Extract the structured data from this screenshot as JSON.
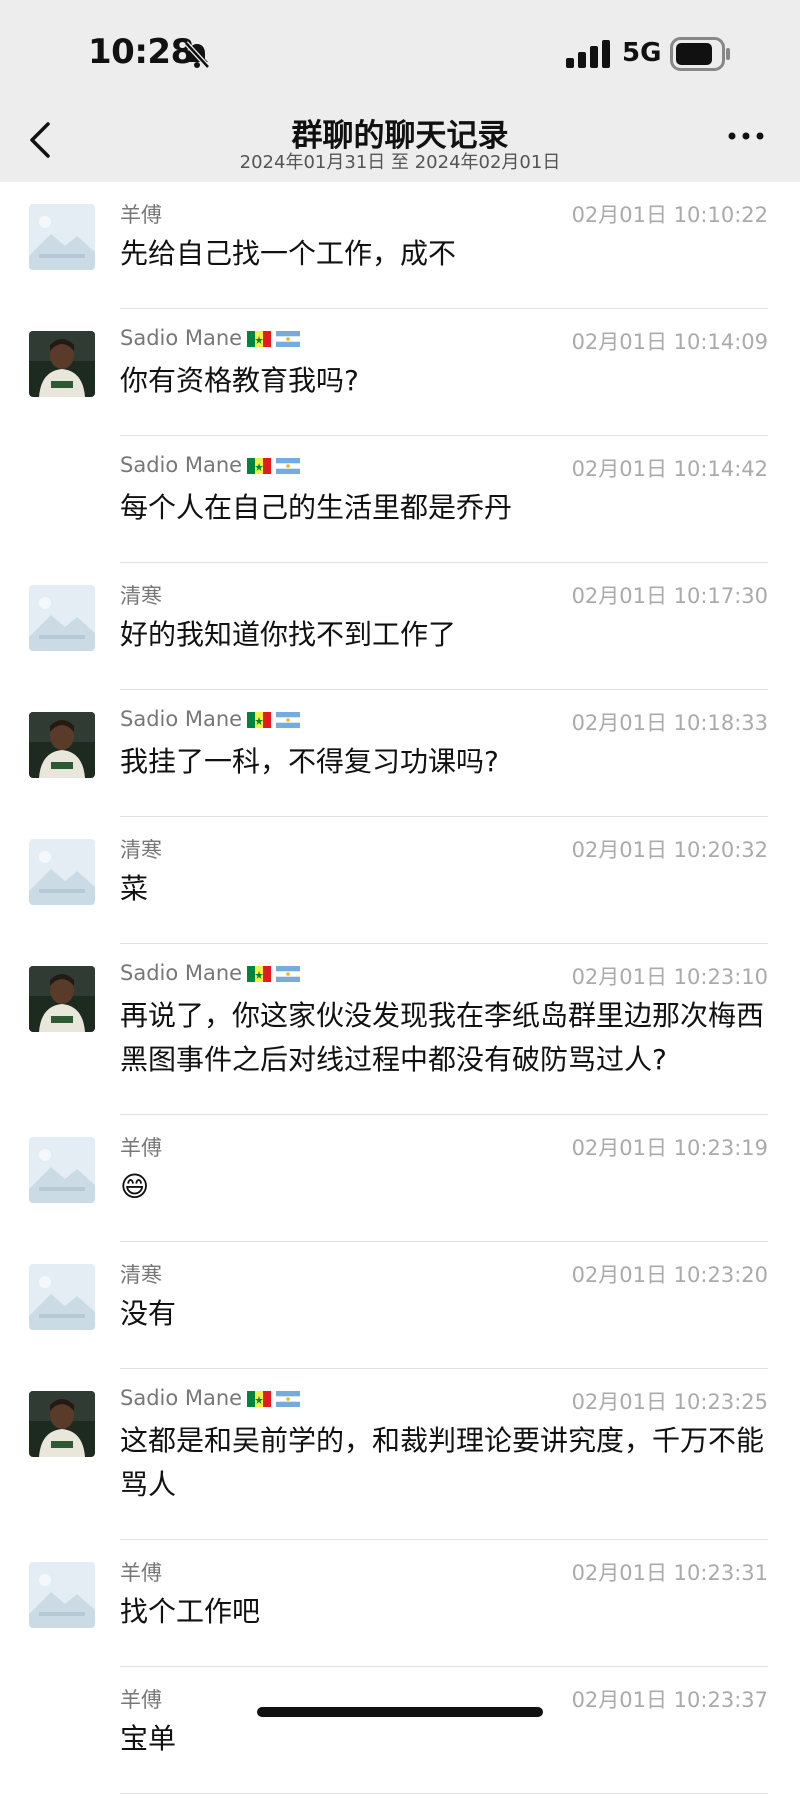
{
  "status_bar": {
    "time": "10:28",
    "network": "5G"
  },
  "header": {
    "title": "群聊的聊天记录",
    "date_range": "2024年01月31日 至 2024年02月01日"
  },
  "icons": {
    "back": "chevron-left-icon",
    "more": "more-dots-icon",
    "mute": "bell-slash-icon"
  },
  "messages": [
    {
      "sender": "羊傅",
      "time": "02月01日 10:10:22",
      "text": "先给自己找一个工作，成不",
      "avatar": "placeholder",
      "show_avatar": true
    },
    {
      "sender": "Sadio Mane",
      "flags": [
        "senegal",
        "argentina"
      ],
      "time": "02月01日 10:14:09",
      "text": "你有资格教育我吗?",
      "avatar": "photo",
      "show_avatar": true
    },
    {
      "sender": "Sadio Mane",
      "flags": [
        "senegal",
        "argentina"
      ],
      "time": "02月01日 10:14:42",
      "text": "每个人在自己的生活里都是乔丹",
      "avatar": "none",
      "show_avatar": false
    },
    {
      "sender": "清寒",
      "time": "02月01日 10:17:30",
      "text": "好的我知道你找不到工作了",
      "avatar": "placeholder",
      "show_avatar": true
    },
    {
      "sender": "Sadio Mane",
      "flags": [
        "senegal",
        "argentina"
      ],
      "time": "02月01日 10:18:33",
      "text": "我挂了一科，不得复习功课吗?",
      "avatar": "photo",
      "show_avatar": true
    },
    {
      "sender": "清寒",
      "time": "02月01日 10:20:32",
      "text": "菜",
      "avatar": "placeholder",
      "show_avatar": true
    },
    {
      "sender": "Sadio Mane",
      "flags": [
        "senegal",
        "argentina"
      ],
      "time": "02月01日 10:23:10",
      "text": "再说了，你这家伙没发现我在李纸岛群里边那次梅西黑图事件之后对线过程中都没有破防骂过人?",
      "avatar": "photo",
      "show_avatar": true
    },
    {
      "sender": "羊傅",
      "time": "02月01日 10:23:19",
      "text": "😄",
      "avatar": "placeholder",
      "show_avatar": true
    },
    {
      "sender": "清寒",
      "time": "02月01日 10:23:20",
      "text": "没有",
      "avatar": "placeholder",
      "show_avatar": true
    },
    {
      "sender": "Sadio Mane",
      "flags": [
        "senegal",
        "argentina"
      ],
      "time": "02月01日 10:23:25",
      "text": "这都是和吴前学的，和裁判理论要讲究度，千万不能骂人",
      "avatar": "photo",
      "show_avatar": true
    },
    {
      "sender": "羊傅",
      "time": "02月01日 10:23:31",
      "text": "找个工作吧",
      "avatar": "placeholder",
      "show_avatar": true
    },
    {
      "sender": "羊傅",
      "time": "02月01日 10:23:37",
      "text": "宝单",
      "avatar": "none",
      "show_avatar": false
    }
  ]
}
